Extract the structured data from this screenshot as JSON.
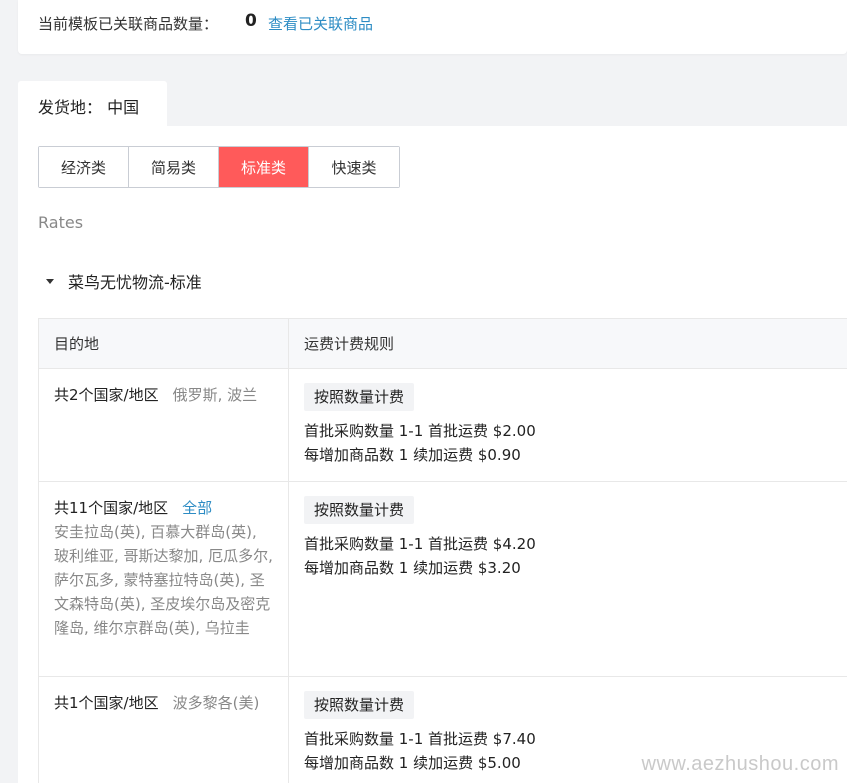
{
  "top": {
    "label": "当前模板已关联商品数量：",
    "count": "0",
    "link": "查看已关联商品"
  },
  "origin": {
    "label": "发货地： 中国"
  },
  "categories": [
    {
      "label": "经济类",
      "active": false
    },
    {
      "label": "简易类",
      "active": false
    },
    {
      "label": "标准类",
      "active": true
    },
    {
      "label": "快速类",
      "active": false
    }
  ],
  "rates_label": "Rates",
  "carrier": {
    "name": "菜鸟无忧物流-标准"
  },
  "table": {
    "headers": {
      "destination": "目的地",
      "rule": "运费计费规则"
    },
    "rows": [
      {
        "count_text": "共2个国家/地区",
        "countries": "俄罗斯, 波兰",
        "tag": "按照数量计费",
        "line1": "首批采购数量 1-1   首批运费 $2.00",
        "line2": "每增加商品数 1   续加运费 $0.90"
      },
      {
        "count_text": "共11个国家/地区",
        "all_link": "全部",
        "countries": "安圭拉岛(英), 百慕大群岛(英), 玻利维亚, 哥斯达黎加, 厄瓜多尔, 萨尔瓦多, 蒙特塞拉特岛(英), 圣文森特岛(英), 圣皮埃尔岛及密克隆岛, 维尔京群岛(英), 乌拉圭",
        "tag": "按照数量计费",
        "line1": "首批采购数量 1-1   首批运费 $4.20",
        "line2": "每增加商品数 1   续加运费 $3.20"
      },
      {
        "count_text": "共1个国家/地区",
        "countries": "波多黎各(美)",
        "tag": "按照数量计费",
        "line1": "首批采购数量 1-1   首批运费 $7.40",
        "line2": "每增加商品数 1   续加运费 $5.00"
      }
    ]
  },
  "watermark": "www.aezhushou.com",
  "colors": {
    "accent": "#ff5a5a",
    "link": "#2d8cc4"
  }
}
